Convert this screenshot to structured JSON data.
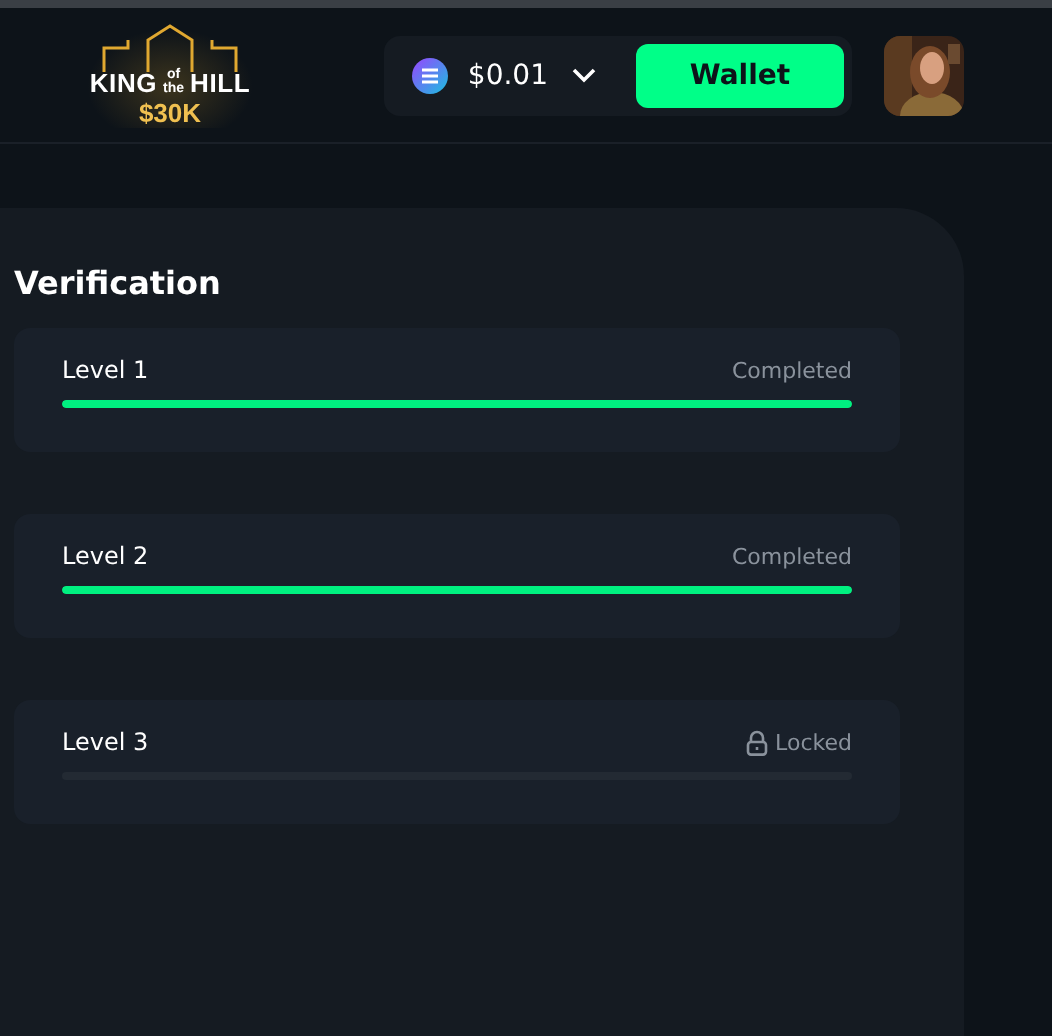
{
  "header": {
    "logo": {
      "word_1": "KING",
      "small_1": "of",
      "small_2": "the",
      "word_2": "HILL",
      "prize": "$30K"
    },
    "balance": {
      "amount": "$0.01",
      "expanded": false
    },
    "wallet_button": "Wallet"
  },
  "verification": {
    "title": "Verification",
    "levels": [
      {
        "label": "Level 1",
        "status": "Completed",
        "kind": "completed",
        "level": 1
      },
      {
        "label": "Level 2",
        "status": "Completed",
        "kind": "completed",
        "level": 1
      },
      {
        "label": "Level 3",
        "status": "Locked",
        "kind": "locked",
        "level": 0
      }
    ]
  }
}
